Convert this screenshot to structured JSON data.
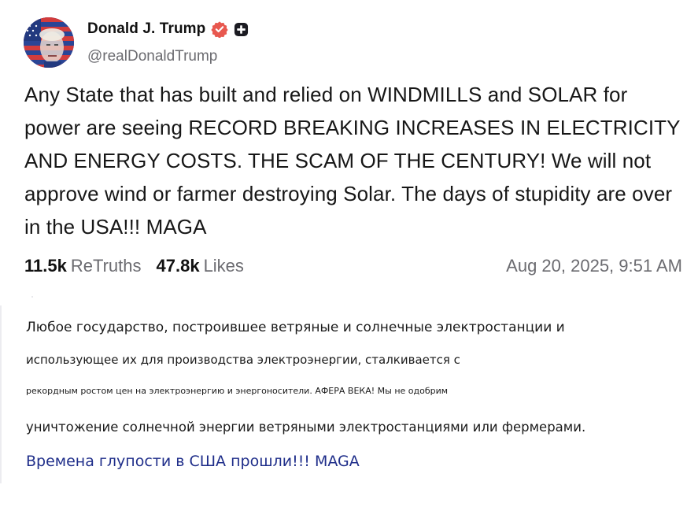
{
  "post": {
    "author": {
      "display_name": "Donald J. Trump",
      "handle": "@realDonaldTrump",
      "verified_icon": "verified-badge-icon",
      "extra_icon": "plus-badge-icon"
    },
    "text": "Any State that has built and relied on WINDMILLS and SOLAR for power are seeing RECORD BREAKING INCREASES IN ELECTRICITY AND ENERGY COSTS. THE SCAM OF THE CENTURY! We will not approve wind or farmer destroying Solar. The days of stupidity are over in the USA!!! MAGA",
    "stats": {
      "retruths_count": "11.5k",
      "retruths_label": "ReTruths",
      "likes_count": "47.8k",
      "likes_label": "Likes"
    },
    "timestamp": "Aug 20, 2025, 9:51 AM"
  },
  "translation": {
    "lines": [
      "Любое государство, построившее ветряные и солнечные электростанции и",
      "использующее их для производства электроэнергии, сталкивается с",
      "рекордным ростом цен на электроэнергию и энергоносители. АФЕРА ВЕКА! Мы не одобрим",
      "уничтожение солнечной энергии ветряными электростанциями или фермерами.",
      "Времена глупости в США прошли!!! MAGA"
    ]
  },
  "colors": {
    "verified": "#e8584f",
    "text_primary": "#171717",
    "text_muted": "#6b6b70",
    "translation_last_line": "#1f2e8a"
  }
}
